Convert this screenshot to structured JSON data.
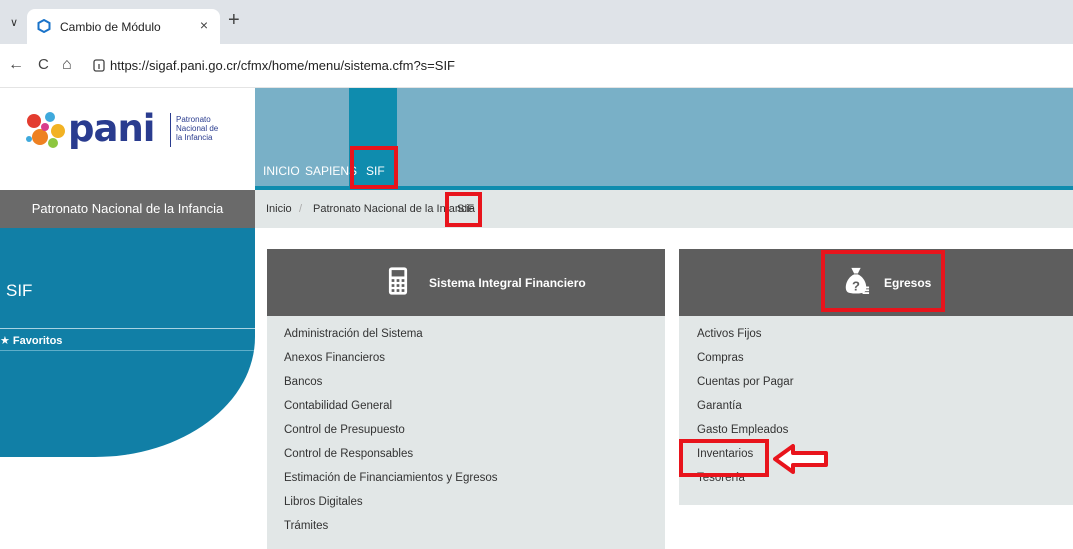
{
  "browser": {
    "tab_title": "Cambio de Módulo",
    "tab_close": "×",
    "new_tab": "+",
    "tab_list": "∨",
    "url": "https://sigaf.pani.go.cr/cfmx/home/menu/sistema.cfm?s=SIF",
    "back": "←",
    "reload": "C",
    "home": "⌂"
  },
  "logo": {
    "word": "pani",
    "subtitle_lines": [
      "Patronato",
      "Nacional de",
      "la Infancia"
    ]
  },
  "topnav": {
    "items": [
      "INICIO",
      "SAPIENS",
      "SIF"
    ],
    "active": "SIF"
  },
  "sidebar": {
    "org_title": "Patronato Nacional de la Infancia",
    "heading": "SIF",
    "favorites": "★ Favoritos"
  },
  "breadcrumb": {
    "items": [
      "Inicio",
      "Patronato Nacional de la Infancia",
      "SIF"
    ],
    "separator": "/"
  },
  "panels": [
    {
      "title": "Sistema Integral Financiero",
      "icon": "calculator-icon",
      "items": [
        "Administración del Sistema",
        "Anexos Financieros",
        "Bancos",
        "Contabilidad General",
        "Control de Presupuesto",
        "Control de Responsables",
        "Estimación de Financiamientos y Egresos",
        "Libros Digitales",
        "Trámites"
      ]
    },
    {
      "title": "Egresos",
      "icon": "money-bag-icon",
      "items": [
        "Activos Fijos",
        "Compras",
        "Cuentas por Pagar",
        "Garantía",
        "Gasto Empleados",
        "Inventarios",
        "Tesorería"
      ]
    }
  ],
  "colors": {
    "annotation_red": "#e8141c",
    "nav_bar": "#79b0c7",
    "nav_active": "#0f8cae",
    "sidebar": "#117fa6",
    "panel_header": "#5e5e5e",
    "panel_body": "#e2e7e7"
  }
}
